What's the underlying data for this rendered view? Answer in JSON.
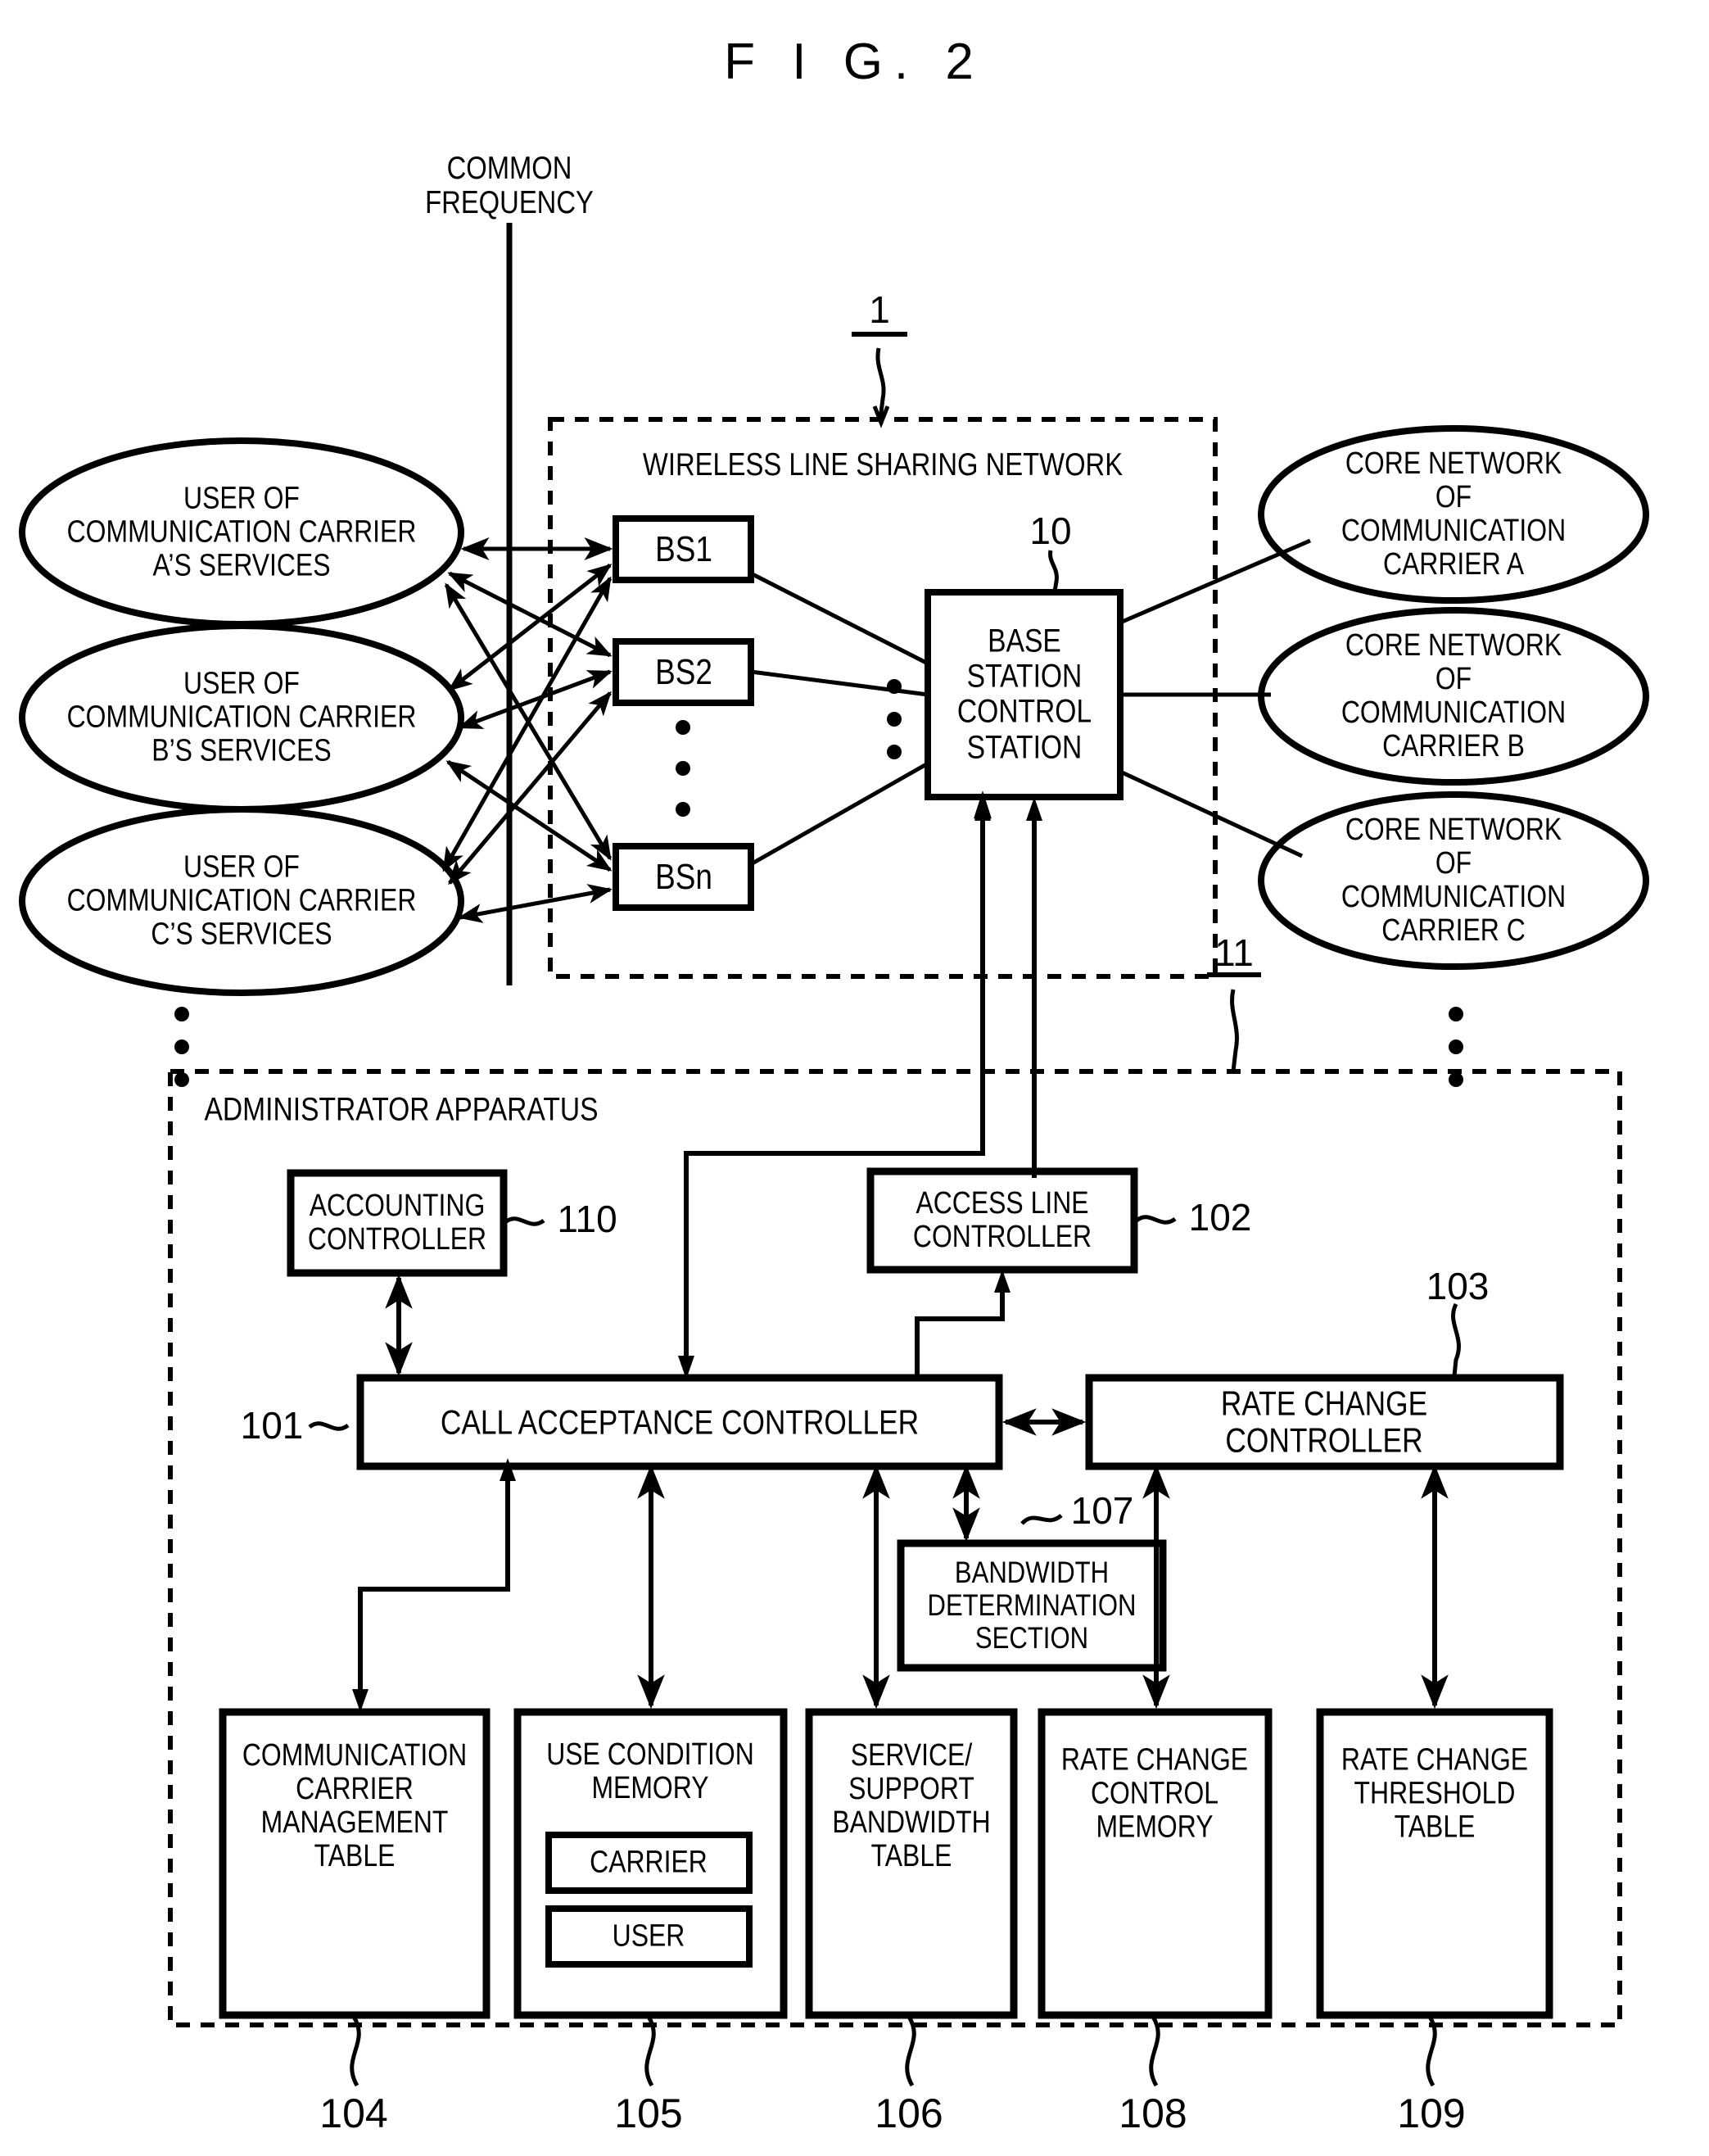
{
  "figure": {
    "title": "F I G. 2"
  },
  "common_frequency": {
    "label": "COMMON\nFREQUENCY"
  },
  "wireless_network": {
    "title": "WIRELESS LINE SHARING NETWORK",
    "ref": "1",
    "base_stations": [
      {
        "label": "BS1"
      },
      {
        "label": "BS2"
      },
      {
        "label": "BSn"
      }
    ],
    "ellipsis": "•",
    "control_station": {
      "label": "BASE\nSTATION\nCONTROL\nSTATION",
      "ref": "10"
    }
  },
  "users": [
    {
      "label": "USER OF\nCOMMUNICATION CARRIER\nA’S SERVICES"
    },
    {
      "label": "USER OF\nCOMMUNICATION CARRIER\nB’S SERVICES"
    },
    {
      "label": "USER OF\nCOMMUNICATION CARRIER\nC’S SERVICES"
    }
  ],
  "core_networks": [
    {
      "label": "CORE NETWORK\nOF COMMUNICATION\nCARRIER A"
    },
    {
      "label": "CORE NETWORK\nOF COMMUNICATION\nCARRIER B"
    },
    {
      "label": "CORE NETWORK\nOF COMMUNICATION\nCARRIER C"
    }
  ],
  "administrator": {
    "title": "ADMINISTRATOR APPARATUS",
    "ref": "11",
    "blocks": {
      "accounting_controller": {
        "label": "ACCOUNTING\nCONTROLLER",
        "ref": "110"
      },
      "access_line_controller": {
        "label": "ACCESS LINE\nCONTROLLER",
        "ref": "102"
      },
      "call_acceptance_controller": {
        "label": "CALL ACCEPTANCE CONTROLLER",
        "ref": "101"
      },
      "rate_change_controller": {
        "label": "RATE CHANGE CONTROLLER",
        "ref": "103"
      },
      "bandwidth_determination_section": {
        "label": "BANDWIDTH\nDETERMINATION\nSECTION",
        "ref": "107"
      }
    },
    "tables": [
      {
        "label": "COMMUNICATION\nCARRIER\nMANAGEMENT\nTABLE",
        "ref": "104",
        "sub": []
      },
      {
        "label": "USE CONDITION\nMEMORY",
        "ref": "105",
        "sub": [
          {
            "label": "CARRIER"
          },
          {
            "label": "USER"
          }
        ]
      },
      {
        "label": "SERVICE/\nSUPPORT\nBANDWIDTH\nTABLE",
        "ref": "106",
        "sub": []
      },
      {
        "label": "RATE CHANGE\nCONTROL\nMEMORY",
        "ref": "108",
        "sub": []
      },
      {
        "label": "RATE CHANGE\nTHRESHOLD\nTABLE",
        "ref": "109",
        "sub": []
      }
    ]
  },
  "vertical_dots": {
    "glyph": "•"
  },
  "colors": {
    "ink": "#000000",
    "paper": "#ffffff"
  }
}
